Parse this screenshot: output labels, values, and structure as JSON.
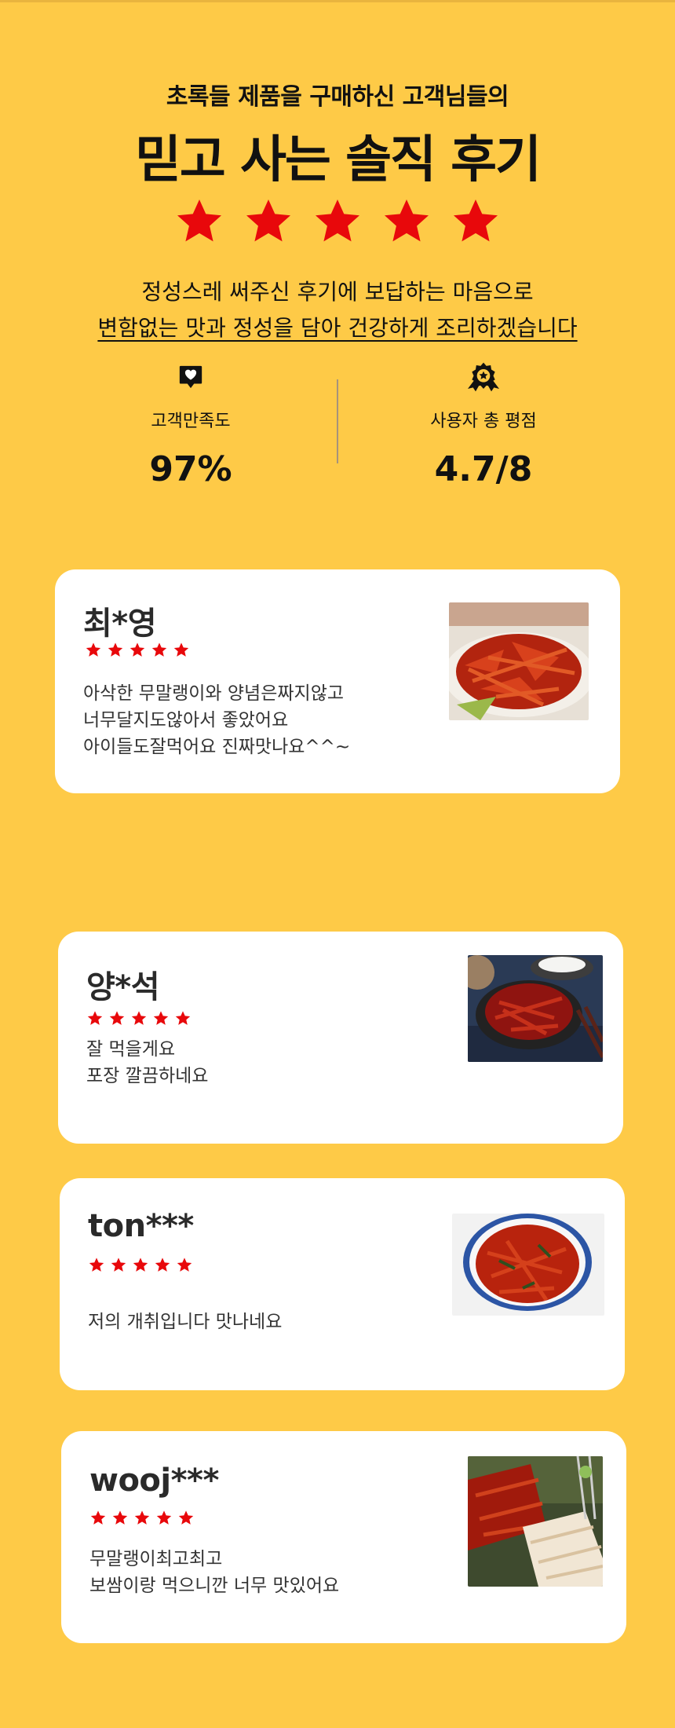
{
  "header": {
    "subtitle": "초록들 제품을 구매하신 고객님들의",
    "title": "믿고 사는 솔직 후기",
    "rating_stars": 5,
    "desc_line1": "정성스레 써주신 후기에 보답하는 마음으로",
    "desc_line2": "변함없는 맛과 정성을 담아 건강하게 조리하겠습니다"
  },
  "stats": {
    "satisfaction": {
      "icon": "heart-message-icon",
      "label": "고객만족도",
      "value": "97%"
    },
    "rating": {
      "icon": "award-badge-icon",
      "label": "사용자 총 평점",
      "value": "4.7/8"
    }
  },
  "colors": {
    "background": "#FECA47",
    "star": "#E8080B",
    "card": "#FFFFFF"
  },
  "reviews": [
    {
      "name": "최*영",
      "stars": 5,
      "text": "아삭한 무말랭이와 양념은짜지않고\n너무달지도않아서 좋았어요\n아이들도잘먹어요 진짜맛나요^^~",
      "photo": "spicy-dish-photo"
    },
    {
      "name": "양*석",
      "stars": 5,
      "text": "잘 먹을게요\n포장 깔끔하네요",
      "photo": "dish-with-rice-photo"
    },
    {
      "name": "ton***",
      "stars": 5,
      "text": "저의 개취입니다 맛나네요",
      "photo": "bowl-photo"
    },
    {
      "name": "wooj***",
      "stars": 5,
      "text": "무말랭이최고최고\n보쌈이랑 먹으니깐 너무 맛있어요",
      "photo": "bossam-photo"
    }
  ]
}
